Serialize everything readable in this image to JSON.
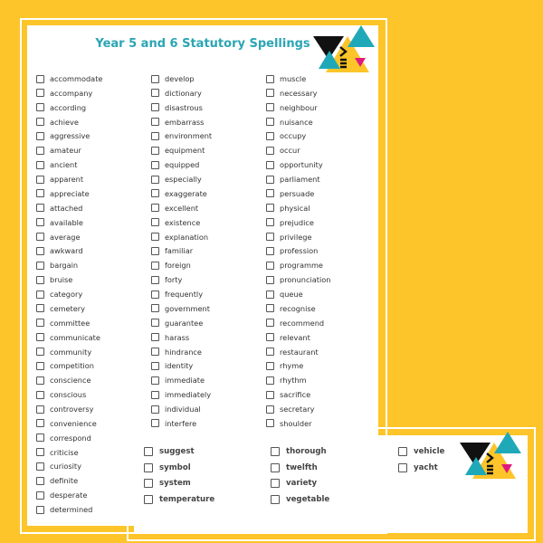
{
  "sheet1": {
    "title": "Year 5 and 6 Statutory Spellings",
    "columns": [
      [
        "accommodate",
        "accompany",
        "according",
        "achieve",
        "aggressive",
        "amateur",
        "ancient",
        "apparent",
        "appreciate",
        "attached",
        "available",
        "average",
        "awkward",
        "bargain",
        "bruise",
        "category",
        "cemetery",
        "committee",
        "communicate",
        "community",
        "competition",
        "conscience",
        "conscious",
        "controversy",
        "convenience",
        "correspond",
        "criticise",
        "curiosity",
        "definite",
        "desperate",
        "determined"
      ],
      [
        "develop",
        "dictionary",
        "disastrous",
        "embarrass",
        "environment",
        "equipment",
        "equipped",
        "especially",
        "exaggerate",
        "excellent",
        "existence",
        "explanation",
        "familiar",
        "foreign",
        "forty",
        "frequently",
        "government",
        "guarantee",
        "harass",
        "hindrance",
        "identity",
        "immediate",
        "immediately",
        "individual",
        "interfere"
      ],
      [
        "muscle",
        "necessary",
        "neighbour",
        "nuisance",
        "occupy",
        "occur",
        "opportunity",
        "parliament",
        "persuade",
        "physical",
        "prejudice",
        "privilege",
        "profession",
        "programme",
        "pronunciation",
        "queue",
        "recognise",
        "recommend",
        "relevant",
        "restaurant",
        "rhyme",
        "rhythm",
        "sacrifice",
        "secretary",
        "shoulder"
      ]
    ]
  },
  "sheet2": {
    "columns": [
      [
        "suggest",
        "symbol",
        "system",
        "temperature"
      ],
      [
        "thorough",
        "twelfth",
        "variety",
        "vegetable"
      ],
      [
        "vehicle",
        "yacht"
      ]
    ]
  },
  "colors": {
    "background": "#fdc52a",
    "title": "#2aa5b3",
    "logo_teal": "#1fa9b8",
    "logo_black": "#111111",
    "logo_yellow": "#fdc52a",
    "logo_pink": "#e0197d"
  }
}
